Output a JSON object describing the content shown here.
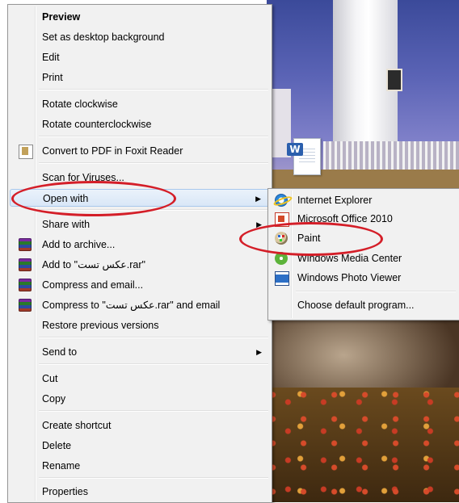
{
  "context_menu": {
    "items": [
      {
        "label": "Preview",
        "bold": true
      },
      {
        "label": "Set as desktop background"
      },
      {
        "label": "Edit"
      },
      {
        "label": "Print"
      },
      {
        "label": "Rotate clockwise"
      },
      {
        "label": "Rotate counterclockwise"
      },
      {
        "label": "Convert to PDF in Foxit Reader",
        "icon": "foxit-icon"
      },
      {
        "label": "Scan for Viruses..."
      },
      {
        "label": "Open with",
        "submenu": true
      },
      {
        "label": "Share with",
        "submenu": true
      },
      {
        "label": "Add to archive...",
        "icon": "winrar-icon"
      },
      {
        "label": "Add to \"عکس تست.rar\"",
        "icon": "winrar-icon"
      },
      {
        "label": "Compress and email...",
        "icon": "winrar-icon"
      },
      {
        "label": "Compress to \"عکس تست.rar\" and email",
        "icon": "winrar-icon"
      },
      {
        "label": "Restore previous versions"
      },
      {
        "label": "Send to",
        "submenu": true
      },
      {
        "label": "Cut"
      },
      {
        "label": "Copy"
      },
      {
        "label": "Create shortcut"
      },
      {
        "label": "Delete"
      },
      {
        "label": "Rename"
      },
      {
        "label": "Properties"
      }
    ],
    "submenu_arrow": "▶"
  },
  "open_with_submenu": {
    "items": [
      {
        "label": "Internet Explorer",
        "icon": "internet-explorer-icon"
      },
      {
        "label": "Microsoft Office 2010",
        "icon": "microsoft-office-icon"
      },
      {
        "label": "Paint",
        "icon": "paint-icon"
      },
      {
        "label": "Windows Media Center",
        "icon": "windows-media-center-icon"
      },
      {
        "label": "Windows Photo Viewer",
        "icon": "windows-photo-viewer-icon"
      },
      {
        "label": "Choose default program..."
      }
    ]
  },
  "desktop": {
    "word_file_badge": "W"
  },
  "colors": {
    "annotation_ring": "#d41e28",
    "menu_background": "#f1f1f1",
    "highlight_border": "#a8c8ec"
  }
}
